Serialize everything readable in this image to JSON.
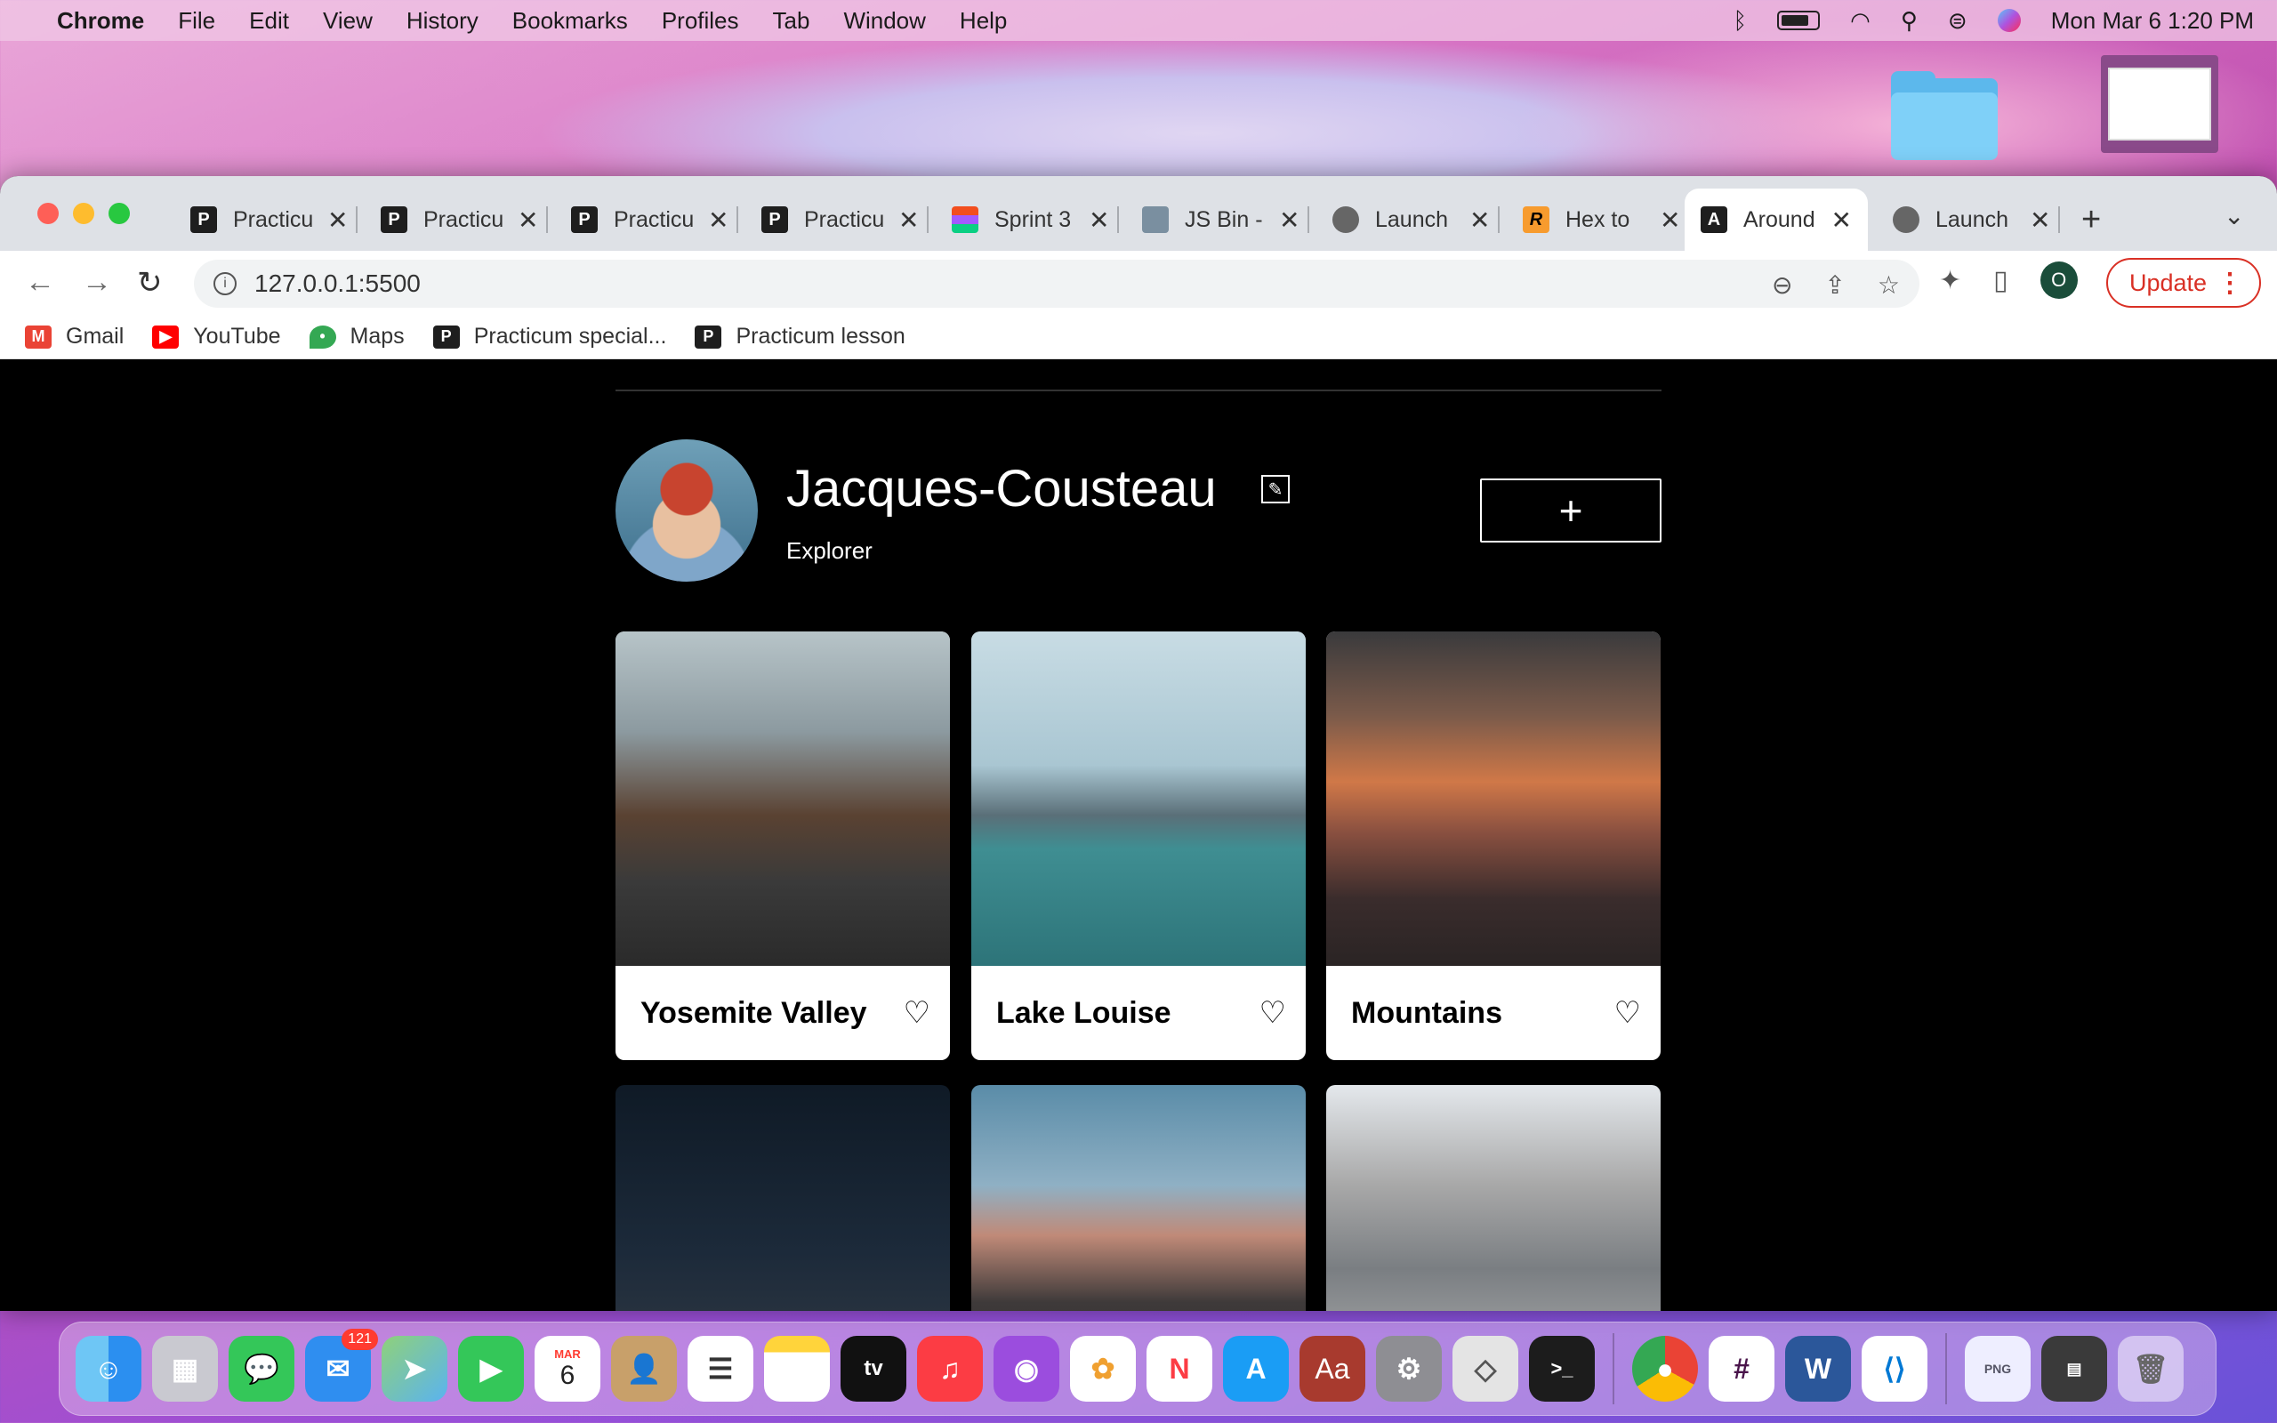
{
  "menubar": {
    "app": "Chrome",
    "items": [
      "File",
      "Edit",
      "View",
      "History",
      "Bookmarks",
      "Profiles",
      "Tab",
      "Window",
      "Help"
    ],
    "clock": "Mon Mar 6  1:20 PM"
  },
  "tabs": [
    {
      "title": "Practicum",
      "icon": "practicum-icon"
    },
    {
      "title": "Practicum",
      "icon": "practicum-icon"
    },
    {
      "title": "Practicum",
      "icon": "practicum-icon"
    },
    {
      "title": "Practicum",
      "icon": "practicum-icon"
    },
    {
      "title": "Sprint 3",
      "icon": "figma-icon"
    },
    {
      "title": "JS Bin -",
      "icon": "jsbin-icon"
    },
    {
      "title": "Launch",
      "icon": "globe-icon"
    },
    {
      "title": "Hex to",
      "icon": "r-icon"
    },
    {
      "title": "Around",
      "icon": "around-icon",
      "active": true
    },
    {
      "title": "Launch",
      "icon": "globe-icon"
    }
  ],
  "toolbar": {
    "url": "127.0.0.1:5500",
    "profile_initial": "O",
    "update_label": "Update"
  },
  "bookmarks": [
    {
      "label": "Gmail",
      "color": "#ea4335"
    },
    {
      "label": "YouTube",
      "color": "#ff0000"
    },
    {
      "label": "Maps",
      "color": "#34a853"
    },
    {
      "label": "Practicum special...",
      "color": "#1e1e1e"
    },
    {
      "label": "Practicum lesson",
      "color": "#1e1e1e"
    }
  ],
  "profile": {
    "name": "Jacques-Cousteau",
    "about": "Explorer",
    "add_label": "+"
  },
  "cards": [
    {
      "title": "Yosemite Valley"
    },
    {
      "title": "Lake Louise"
    },
    {
      "title": "Mountains"
    },
    {
      "title": ""
    },
    {
      "title": ""
    },
    {
      "title": ""
    }
  ],
  "dock": {
    "mail_badge": "121",
    "calendar_month": "MAR",
    "calendar_day": "6"
  }
}
